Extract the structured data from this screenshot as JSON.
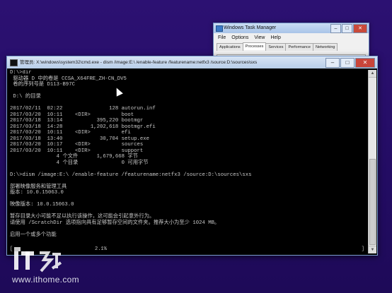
{
  "task_manager": {
    "title": "Windows Task Manager",
    "menu": [
      "File",
      "Options",
      "View",
      "Help"
    ],
    "tabs": [
      "Applications",
      "Processes",
      "Services",
      "Performance",
      "Networking"
    ],
    "active_tab": "Processes",
    "controls": {
      "minimize": "–",
      "maximize": "□",
      "close": "✕"
    }
  },
  "console_window": {
    "title": "管理员: X:\\windows\\system32\\cmd.exe - dism  /image:E:\\ /enable-feature /featurename:netfx3 /source:D:\\sources\\sxs",
    "controls": {
      "minimize": "–",
      "maximize": "□",
      "close": "✕"
    },
    "lines": [
      "D:\\>dir",
      " 驱动器 D 中的卷是 CCSA_X64FRE_ZH-CN_DV5",
      " 卷的序列号是 D113-B97C",
      "",
      " D:\\ 的目录",
      "",
      "2017/02/11  02:22               128 autorun.inf",
      "2017/03/20  10:11    <DIR>          boot",
      "2017/03/18  13:14           395,220 bootmgr",
      "2017/03/18  14:28         1,202,618 bootmgr.efi",
      "2017/03/20  10:11    <DIR>          efi",
      "2017/03/18  13:40            30,704 setup.exe",
      "2017/03/20  10:17    <DIR>          sources",
      "2017/03/20  10:11    <DIR>          support",
      "               4 个文件      1,679,668 字节",
      "               4 个目录              0 可用字节",
      "",
      "D:\\>dism /image:E:\\ /enable-feature /featurename:netfx3 /source:D:\\sources\\sxs",
      "",
      "部署映像服务和管理工具",
      "版本: 10.0.15063.0",
      "",
      "映像版本: 10.0.15063.0",
      "",
      "暂存目录大小可能不足以执行该操作，这可能会引起意外行为。",
      "请使用 /ScratchDir 选项指向具有足够暂存空间的文件夹。推荐大小为至少 1024 MB。",
      "",
      "启用一个或多个功能"
    ],
    "progress": {
      "percent_label": "2.1%",
      "value_percent": 2.1
    }
  },
  "watermark": {
    "logo_text": "IT之家",
    "url": "www.ithome.com"
  }
}
